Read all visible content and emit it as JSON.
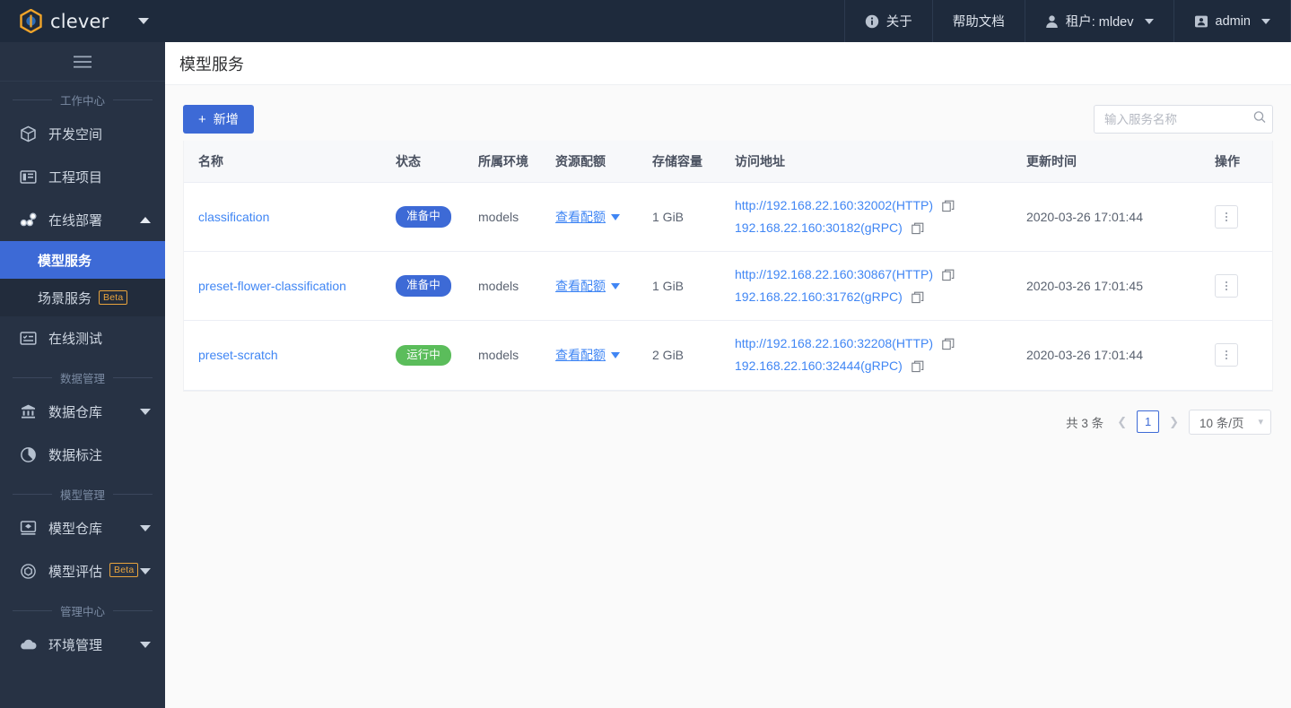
{
  "brand": {
    "name": "clever",
    "logo_icon": "hexagon-logo-icon",
    "caret_icon": "chevron-down-icon"
  },
  "topnav": [
    {
      "label": "关于",
      "icon": "info-icon",
      "has_caret": false
    },
    {
      "label": "帮助文档",
      "icon": "",
      "has_caret": false
    },
    {
      "label": "租户: mldev",
      "icon": "user-icon",
      "has_caret": true
    },
    {
      "label": "admin",
      "icon": "id-card-icon",
      "has_caret": true
    }
  ],
  "sidebar": {
    "hamburger_icon": "hamburger-menu-icon",
    "groups": [
      {
        "title": "工作中心",
        "items": [
          {
            "label": "开发空间",
            "icon": "cube-icon",
            "expandable": false
          },
          {
            "label": "工程项目",
            "icon": "project-board-icon",
            "expandable": false
          },
          {
            "label": "在线部署",
            "icon": "deploy-nodes-icon",
            "expandable": true,
            "expanded": true,
            "children": [
              {
                "label": "模型服务",
                "active": true,
                "beta": false
              },
              {
                "label": "场景服务",
                "active": false,
                "beta": true,
                "beta_label": "Beta"
              }
            ]
          },
          {
            "label": "在线测试",
            "icon": "test-list-icon",
            "expandable": false
          }
        ]
      },
      {
        "title": "数据管理",
        "items": [
          {
            "label": "数据仓库",
            "icon": "database-bank-icon",
            "expandable": true,
            "expanded": false
          },
          {
            "label": "数据标注",
            "icon": "annotate-pie-icon",
            "expandable": false
          }
        ]
      },
      {
        "title": "模型管理",
        "items": [
          {
            "label": "模型仓库",
            "icon": "model-box-icon",
            "expandable": true,
            "expanded": false
          },
          {
            "label": "模型评估",
            "icon": "evaluate-hex-icon",
            "expandable": true,
            "expanded": false,
            "beta": true,
            "beta_label": "Beta"
          }
        ]
      },
      {
        "title": "管理中心",
        "items": [
          {
            "label": "环境管理",
            "icon": "cloud-icon",
            "expandable": true,
            "expanded": false
          }
        ]
      }
    ]
  },
  "page": {
    "title": "模型服务"
  },
  "toolbar": {
    "add_label": "新增",
    "add_plus": "+",
    "search_placeholder": "输入服务名称",
    "search_value": "",
    "search_icon": "search-icon"
  },
  "table": {
    "columns": [
      "名称",
      "状态",
      "所属环境",
      "资源配额",
      "存储容量",
      "访问地址",
      "更新时间",
      "操作"
    ],
    "quota_link_label": "查看配额",
    "copy_icon": "copy-icon",
    "ops_icon": "more-vertical-icon",
    "rows": [
      {
        "name": "classification",
        "status": "准备中",
        "status_color": "#3d6ad6",
        "status_kind": "blue",
        "env": "models",
        "quota": "查看配额",
        "storage": "1 GiB",
        "addresses": [
          "http://192.168.22.160:32002(HTTP)",
          "192.168.22.160:30182(gRPC)"
        ],
        "updated": "2020-03-26 17:01:44"
      },
      {
        "name": "preset-flower-classification",
        "status": "准备中",
        "status_color": "#3d6ad6",
        "status_kind": "blue",
        "env": "models",
        "quota": "查看配额",
        "storage": "1 GiB",
        "addresses": [
          "http://192.168.22.160:30867(HTTP)",
          "192.168.22.160:31762(gRPC)"
        ],
        "updated": "2020-03-26 17:01:45"
      },
      {
        "name": "preset-scratch",
        "status": "运行中",
        "status_color": "#5bbd5b",
        "status_kind": "green",
        "env": "models",
        "quota": "查看配额",
        "storage": "2 GiB",
        "addresses": [
          "http://192.168.22.160:32208(HTTP)",
          "192.168.22.160:32444(gRPC)"
        ],
        "updated": "2020-03-26 17:01:44"
      }
    ]
  },
  "pagination": {
    "total_label": "共 3 条",
    "prev_icon": "chevron-left-icon",
    "next_icon": "chevron-right-icon",
    "current_page": "1",
    "page_size_label": "10 条/页",
    "page_size_caret": "chevron-down-icon"
  },
  "colors": {
    "accent": "#3d6ad6",
    "link": "#4086f4",
    "sidebar_bg": "#273244",
    "topbar_bg": "#1e2a3c",
    "running": "#5bbd5b",
    "beta": "#e8a33d"
  }
}
